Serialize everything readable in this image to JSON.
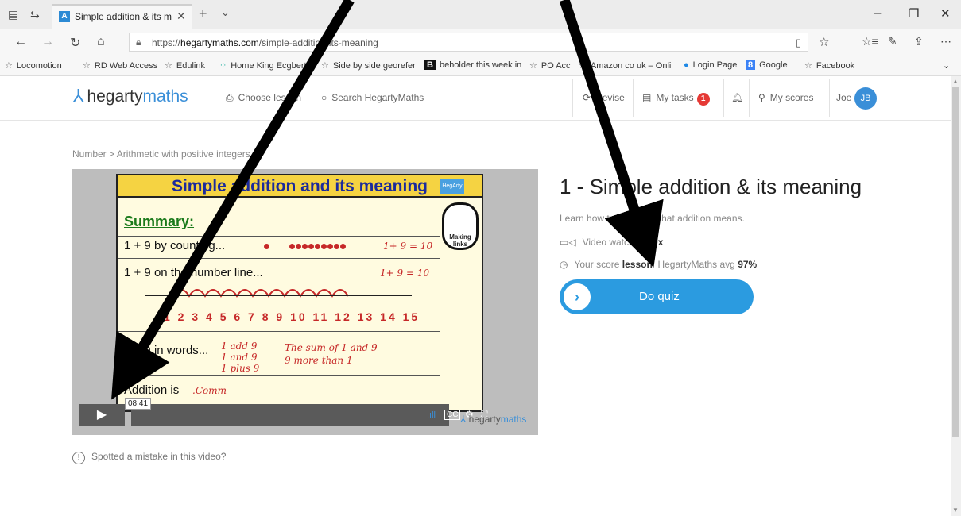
{
  "browser": {
    "tab_title": "Simple addition & its m",
    "tab_favicon": "A",
    "url_prefix": "https://",
    "url_host": "hegartymaths.com",
    "url_path": "/simple-addition-its-meaning",
    "window_controls": [
      "–",
      "❐",
      "✕"
    ]
  },
  "favorites": [
    {
      "label": "Locomotion",
      "icon": "star-icon"
    },
    {
      "label": "RD Web Access",
      "icon": "star-icon"
    },
    {
      "label": "Edulink",
      "icon": "star-icon"
    },
    {
      "label": "Home King Ecgbert S",
      "icon": "dots-icon"
    },
    {
      "label": "Side by side georefer",
      "icon": "star-icon"
    },
    {
      "label": "beholder this week in",
      "icon": "b-icon"
    },
    {
      "label": "PO Acc",
      "icon": "star-icon"
    },
    {
      "label": "Amazon co uk – Onli",
      "icon": "star-icon"
    },
    {
      "label": "Login Page",
      "icon": "edge-icon"
    },
    {
      "label": "Google",
      "icon": "g-icon"
    },
    {
      "label": "Facebook",
      "icon": "star-icon"
    }
  ],
  "header": {
    "logo_a": "hegarty",
    "logo_b": "maths",
    "choose_lesson": "Choose lesson",
    "search_placeholder": "Search HegartyMaths",
    "revise": "Revise",
    "my_tasks": "My tasks",
    "tasks_count": "1",
    "my_scores": "My scores",
    "user_name": "Joe",
    "avatar_initials": "JB"
  },
  "breadcrumb": "Number  >  Arithmetic with positive integers",
  "video": {
    "slide_title": "Simple addition and its meaning",
    "summary": "Summary:",
    "row1": "1 + 9 by counting...",
    "row1_hand": "1+ 9 = 10",
    "row2": "1 + 9 on the number line...",
    "row2_hand": "1+ 9 = 10",
    "numbers": "1 2 3 4 5 6 7 8 9 10 11 12 13 14 15",
    "row3": "1 + 9 in words...",
    "row3_hand_a": "1 add 9",
    "row3_hand_b": "1 and 9",
    "row3_hand_c": "1 plus 9",
    "row3_hand_d": "The sum of 1 and 9",
    "row3_hand_e": "9 more than 1",
    "row4": "Addition is",
    "row4_hand": ".Comm",
    "making_links": "Making links",
    "time": "08:41",
    "player_logo_a": "hegarty",
    "player_logo_b": "maths"
  },
  "report_link": "Spotted a mistake in this video?",
  "lesson": {
    "title": "1 - Simple addition & its meaning",
    "description": "Learn how to add and what addition means.",
    "video_watched_label": "Video watched",
    "video_watched_value": "00x",
    "score_label": "Your score",
    "score_value": "lesson",
    "avg_label": "HegartyMaths avg",
    "avg_value": "97%",
    "quiz_label": "Do quiz"
  }
}
